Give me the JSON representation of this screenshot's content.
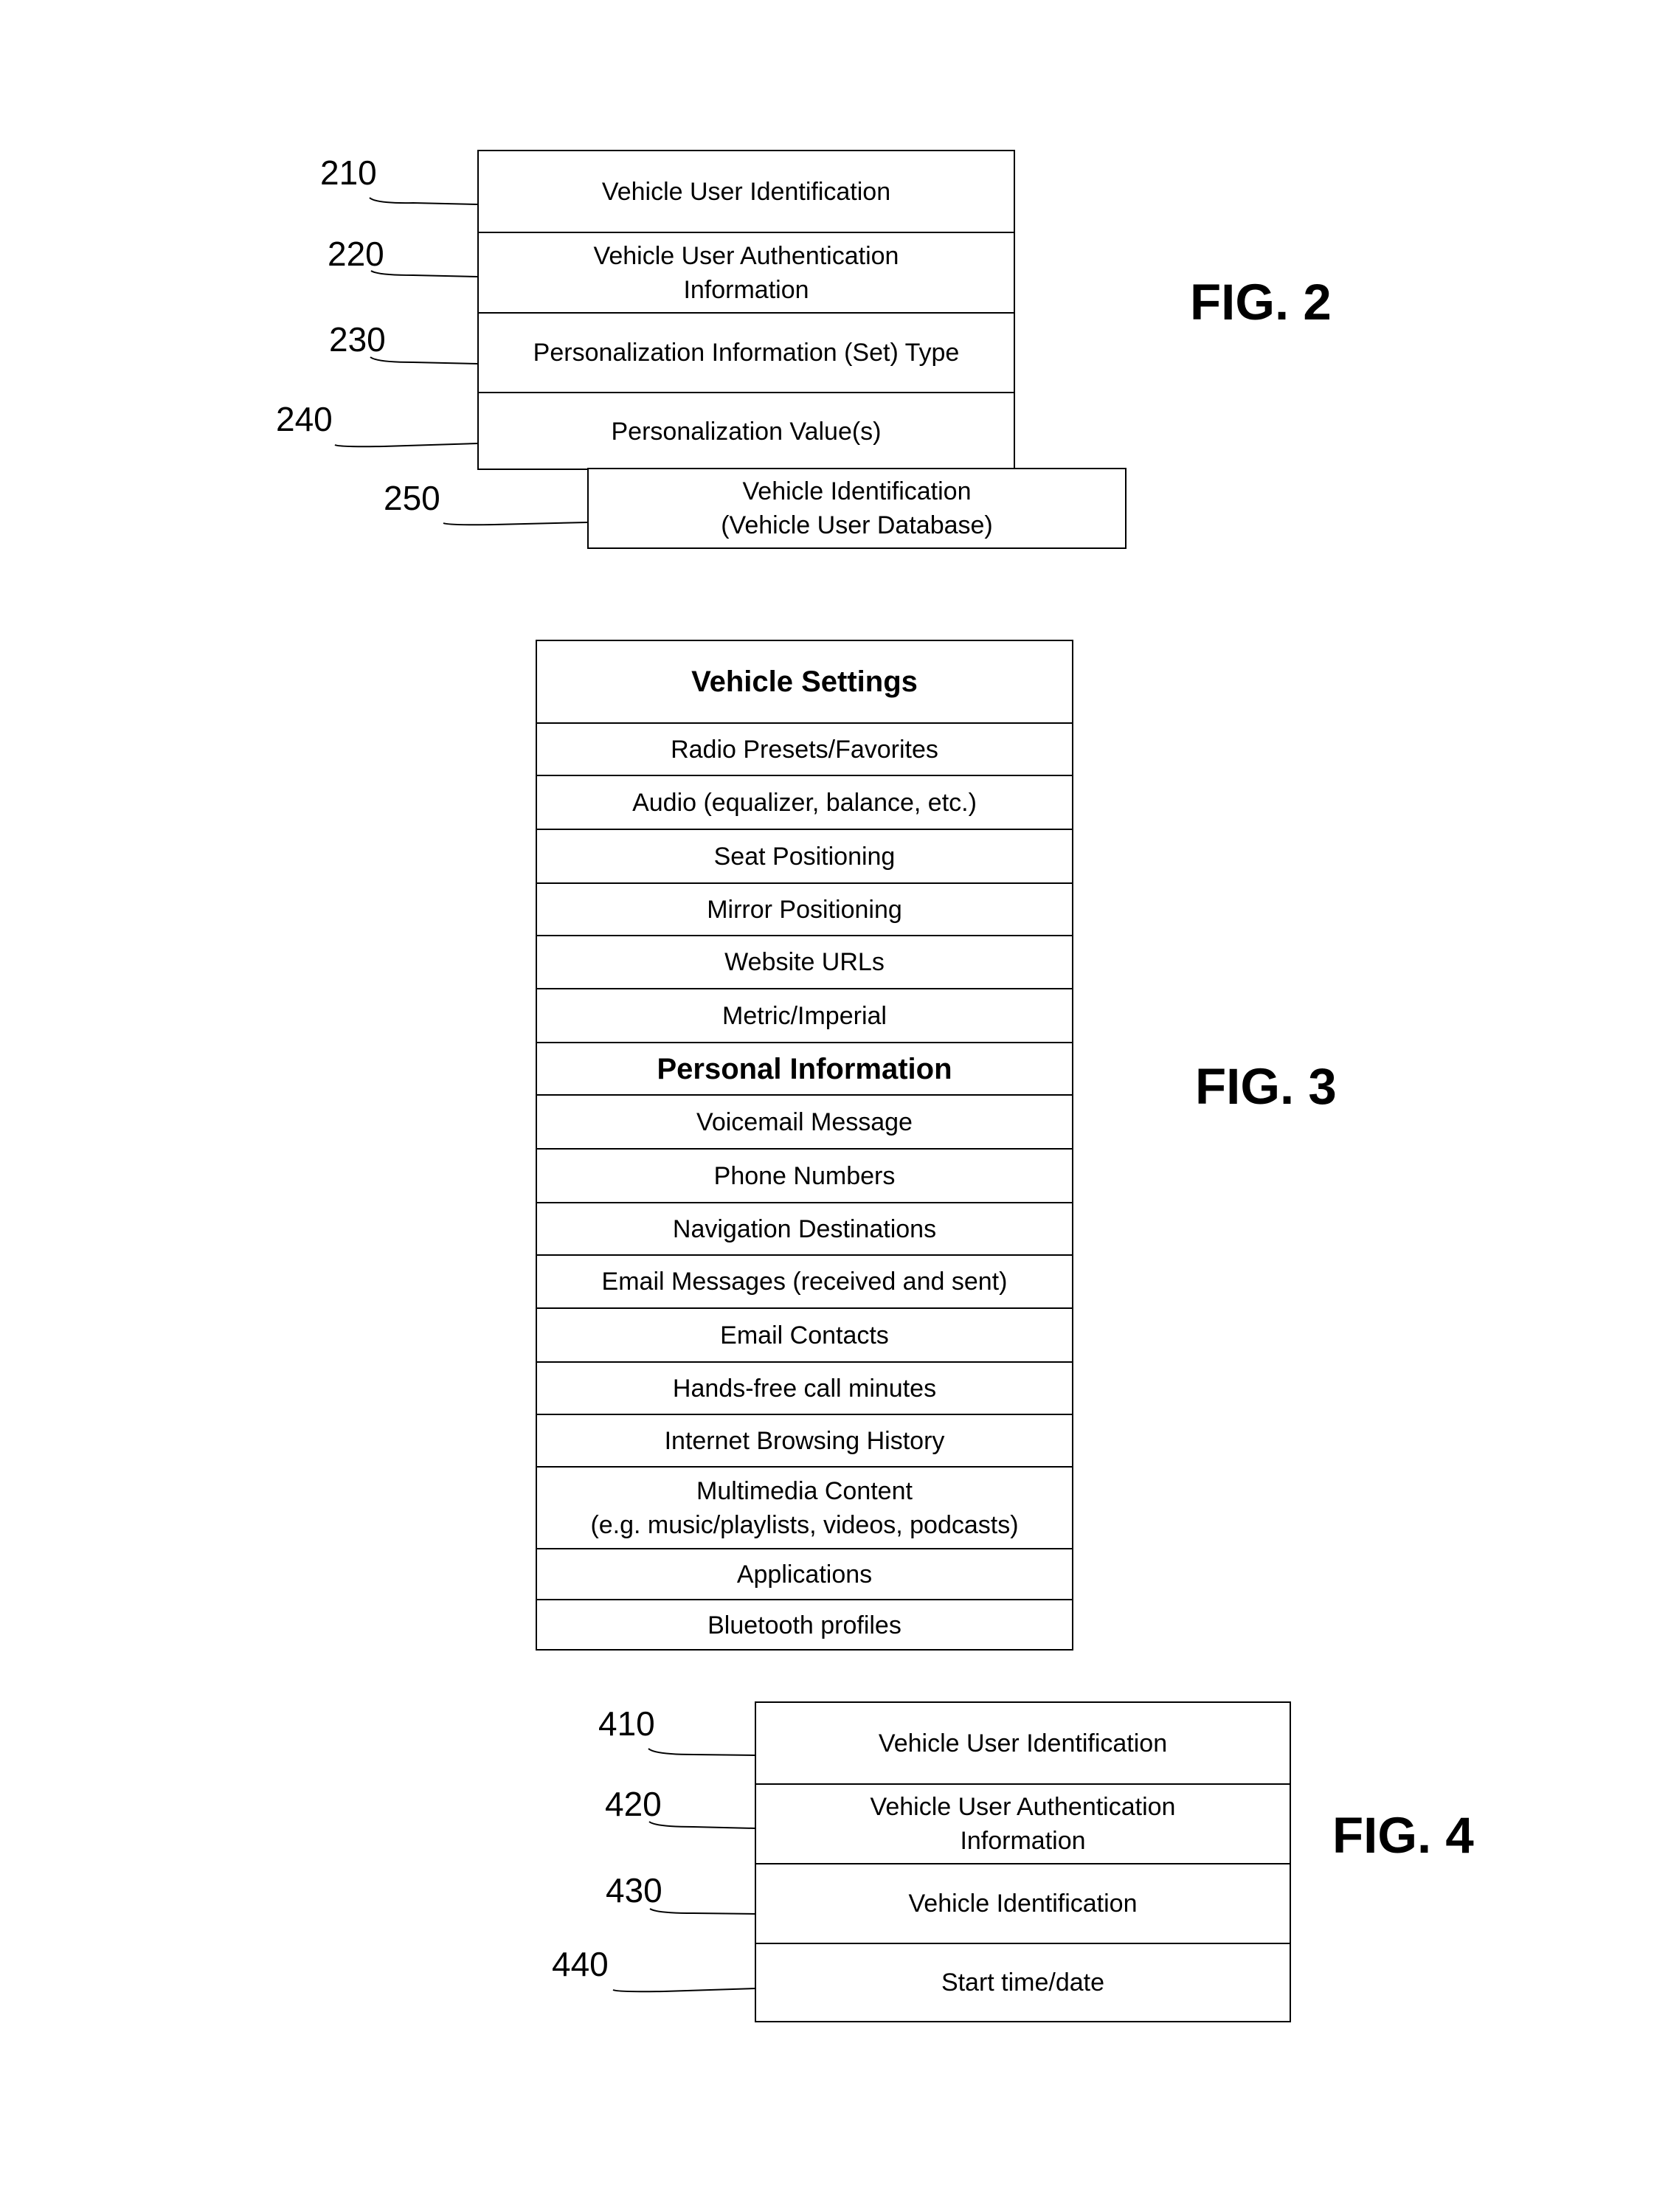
{
  "fig2": {
    "label": "FIG. 2",
    "rows": [
      {
        "ref": "210",
        "text": "Vehicle User Identification"
      },
      {
        "ref": "220",
        "text": "Vehicle User Authentication\nInformation"
      },
      {
        "ref": "230",
        "text": "Personalization Information (Set) Type"
      },
      {
        "ref": "240",
        "text": "Personalization Value(s)"
      }
    ],
    "offset_box": {
      "ref": "250",
      "text": "Vehicle Identification\n(Vehicle User Database)"
    }
  },
  "fig3": {
    "label": "FIG. 3",
    "sections": [
      {
        "header": "Vehicle Settings",
        "items": [
          "Radio Presets/Favorites",
          "Audio (equalizer, balance, etc.)",
          "Seat Positioning",
          "Mirror Positioning",
          "Website URLs",
          "Metric/Imperial"
        ]
      },
      {
        "header": "Personal Information",
        "items": [
          "Voicemail Message",
          "Phone Numbers",
          "Navigation Destinations",
          "Email Messages (received and sent)",
          "Email Contacts",
          "Hands-free call minutes",
          "Internet Browsing History",
          "Multimedia Content\n(e.g. music/playlists, videos, podcasts)",
          "Applications",
          "Bluetooth profiles"
        ]
      }
    ]
  },
  "fig4": {
    "label": "FIG. 4",
    "rows": [
      {
        "ref": "410",
        "text": "Vehicle User Identification"
      },
      {
        "ref": "420",
        "text": "Vehicle User Authentication\nInformation"
      },
      {
        "ref": "430",
        "text": "Vehicle Identification"
      },
      {
        "ref": "440",
        "text": "Start time/date"
      }
    ]
  }
}
